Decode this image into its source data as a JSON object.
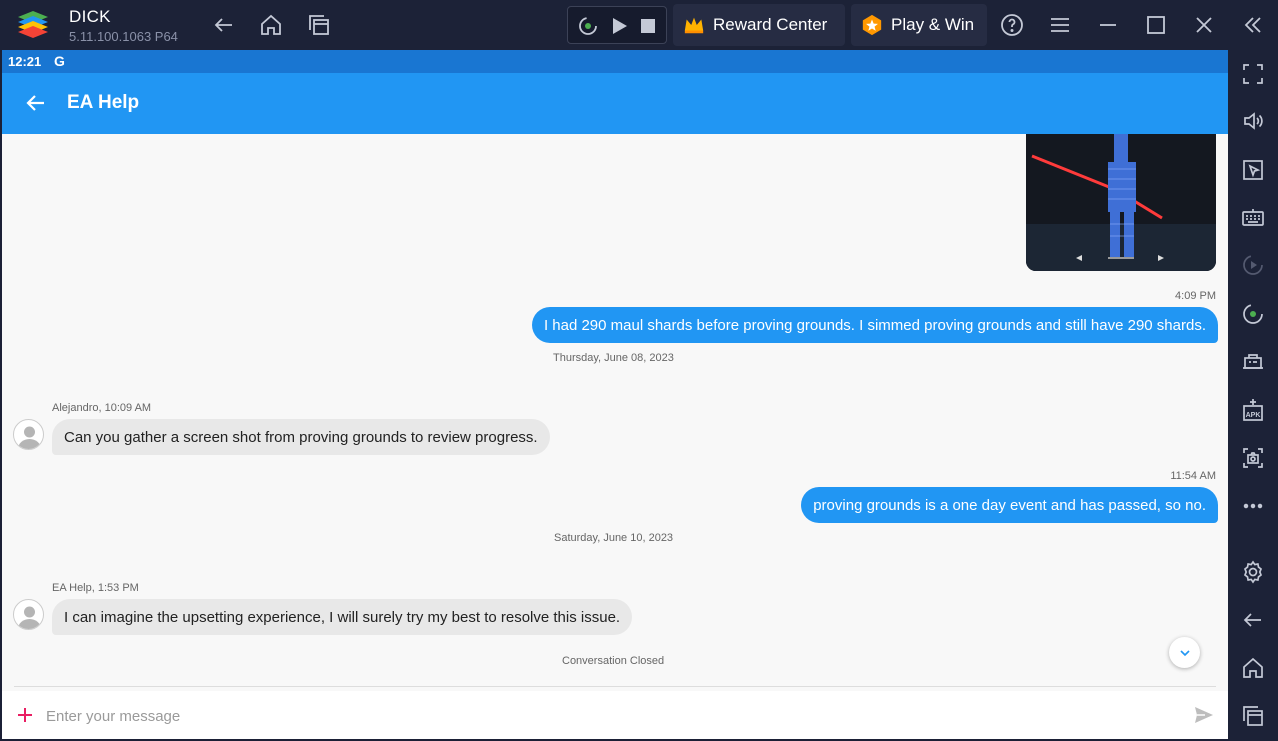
{
  "titlebar": {
    "app_name": "DICK",
    "version": "5.11.100.1063  P64",
    "reward_label": "Reward Center",
    "play_label": "Play & Win",
    "icons": [
      "back-icon",
      "home-icon",
      "multi-instance-icon",
      "record-icon",
      "play-icon",
      "stop-icon",
      "help-icon",
      "menu-icon",
      "minimize-icon",
      "maximize-icon",
      "close-icon",
      "collapse-sidebar-icon"
    ]
  },
  "sidebar": {
    "icons": [
      "fullscreen-icon",
      "volume-icon",
      "pointer-icon",
      "keyboard-icon",
      "macro-play-icon",
      "sync-icon",
      "performance-icon",
      "apk-install-icon",
      "screenshot-icon",
      "more-icon",
      "settings-icon",
      "android-back-icon",
      "android-home-icon",
      "android-recents-icon"
    ]
  },
  "statusbar": {
    "time": "12:21",
    "g_icon": "G"
  },
  "appbar": {
    "title": "EA Help"
  },
  "messages": [
    {
      "type": "out",
      "time": "4:09 PM",
      "text": "I had 290 maul shards before proving grounds. I simmed proving grounds and still have 290 shards."
    },
    {
      "type": "date",
      "text": "Thursday, June 08, 2023"
    },
    {
      "type": "in",
      "sender": "Alejandro, 10:09 AM",
      "text": "Can you gather a screen shot from proving grounds to review progress."
    },
    {
      "type": "out",
      "time": "11:54 AM",
      "text": "proving grounds is a one day event and has passed, so no."
    },
    {
      "type": "date",
      "text": "Saturday, June 10, 2023"
    },
    {
      "type": "in",
      "sender": "EA Help, 1:53 PM",
      "text": "I can imagine the upsetting experience, I will surely try my best to resolve this issue."
    }
  ],
  "conversation_status": "Conversation Closed",
  "composer": {
    "placeholder": "Enter your message"
  },
  "colors": {
    "accent": "#2196f3",
    "statusbar": "#1976d2",
    "chrome": "#1c2237",
    "plus": "#e91e63"
  }
}
